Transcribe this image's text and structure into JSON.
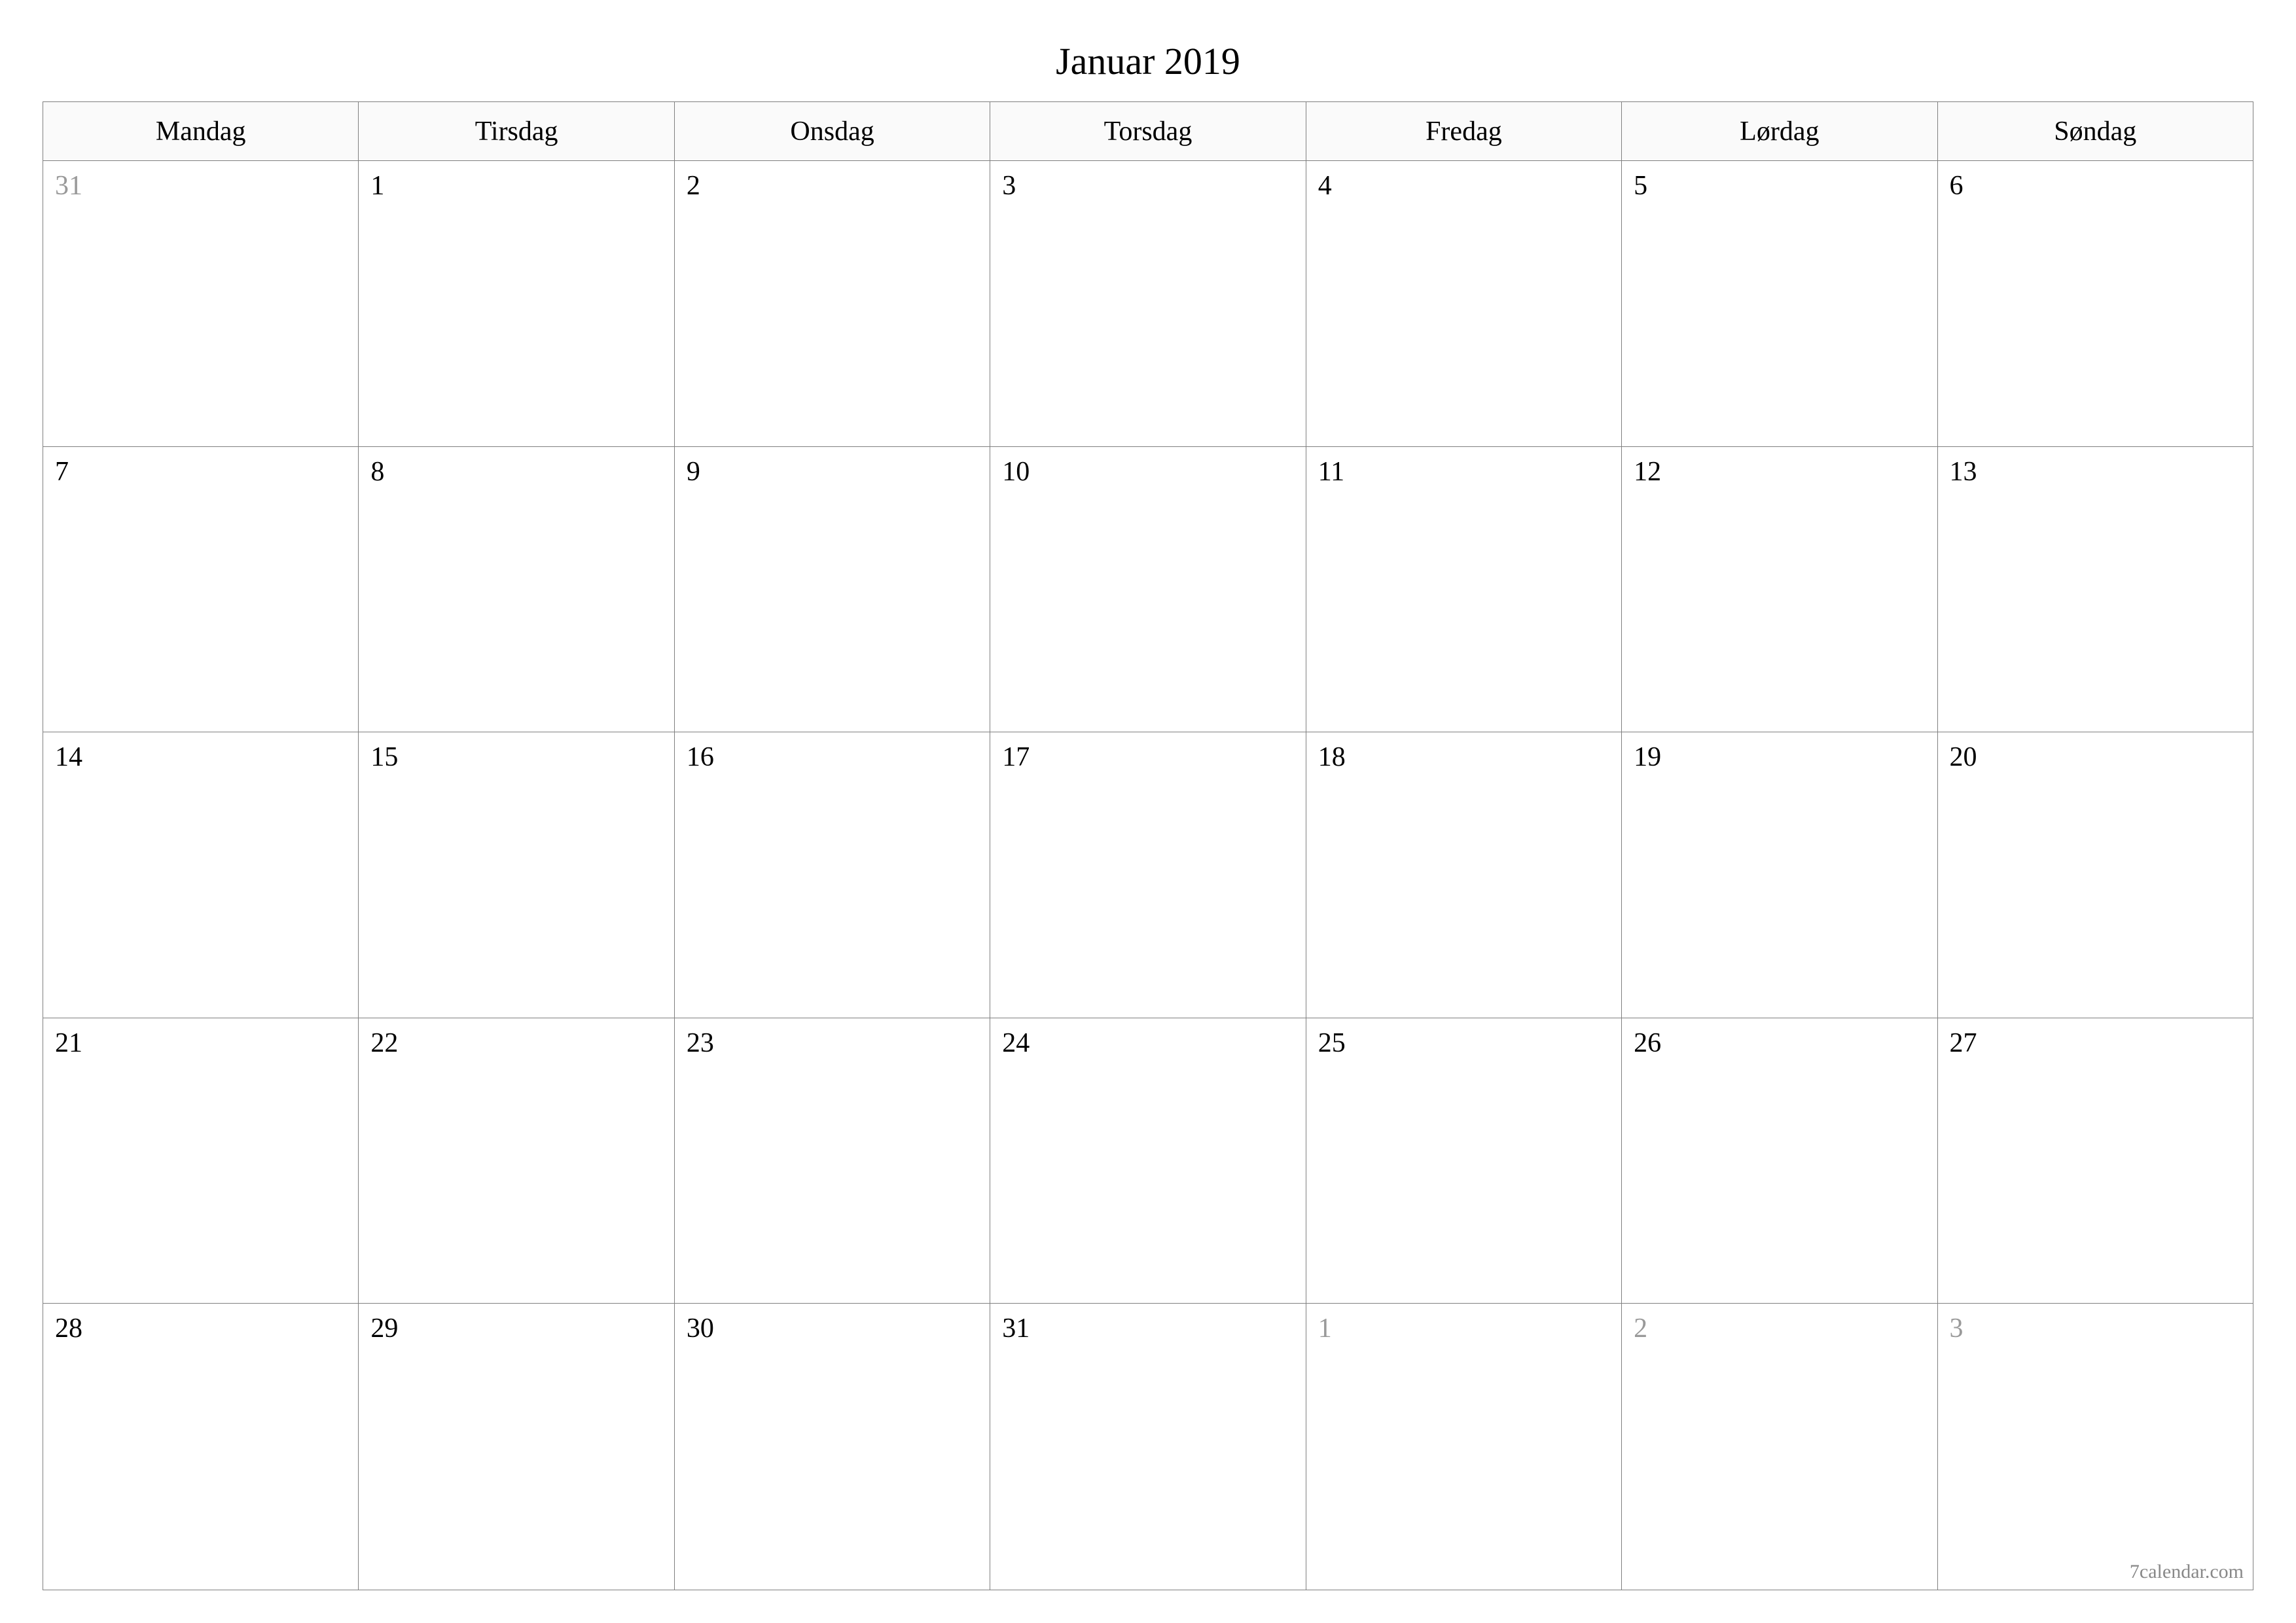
{
  "title": "Januar 2019",
  "weekdays": [
    "Mandag",
    "Tirsdag",
    "Onsdag",
    "Torsdag",
    "Fredag",
    "Lørdag",
    "Søndag"
  ],
  "weeks": [
    [
      {
        "day": "31",
        "otherMonth": true
      },
      {
        "day": "1",
        "otherMonth": false
      },
      {
        "day": "2",
        "otherMonth": false
      },
      {
        "day": "3",
        "otherMonth": false
      },
      {
        "day": "4",
        "otherMonth": false
      },
      {
        "day": "5",
        "otherMonth": false
      },
      {
        "day": "6",
        "otherMonth": false
      }
    ],
    [
      {
        "day": "7",
        "otherMonth": false
      },
      {
        "day": "8",
        "otherMonth": false
      },
      {
        "day": "9",
        "otherMonth": false
      },
      {
        "day": "10",
        "otherMonth": false
      },
      {
        "day": "11",
        "otherMonth": false
      },
      {
        "day": "12",
        "otherMonth": false
      },
      {
        "day": "13",
        "otherMonth": false
      }
    ],
    [
      {
        "day": "14",
        "otherMonth": false
      },
      {
        "day": "15",
        "otherMonth": false
      },
      {
        "day": "16",
        "otherMonth": false
      },
      {
        "day": "17",
        "otherMonth": false
      },
      {
        "day": "18",
        "otherMonth": false
      },
      {
        "day": "19",
        "otherMonth": false
      },
      {
        "day": "20",
        "otherMonth": false
      }
    ],
    [
      {
        "day": "21",
        "otherMonth": false
      },
      {
        "day": "22",
        "otherMonth": false
      },
      {
        "day": "23",
        "otherMonth": false
      },
      {
        "day": "24",
        "otherMonth": false
      },
      {
        "day": "25",
        "otherMonth": false
      },
      {
        "day": "26",
        "otherMonth": false
      },
      {
        "day": "27",
        "otherMonth": false
      }
    ],
    [
      {
        "day": "28",
        "otherMonth": false
      },
      {
        "day": "29",
        "otherMonth": false
      },
      {
        "day": "30",
        "otherMonth": false
      },
      {
        "day": "31",
        "otherMonth": false
      },
      {
        "day": "1",
        "otherMonth": true
      },
      {
        "day": "2",
        "otherMonth": true
      },
      {
        "day": "3",
        "otherMonth": true
      }
    ]
  ],
  "footer": "7calendar.com"
}
